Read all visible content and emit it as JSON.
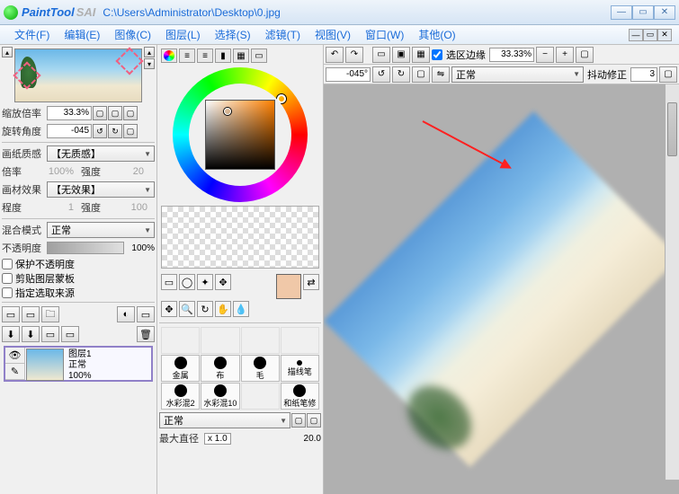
{
  "title": {
    "app": "PaintTool",
    "suffix": "SAI",
    "path": "C:\\Users\\Administrator\\Desktop\\0.jpg"
  },
  "menu": {
    "file": "文件(F)",
    "edit": "编辑(E)",
    "image": "图像(C)",
    "layer": "图层(L)",
    "select": "选择(S)",
    "filter": "滤镜(T)",
    "view": "视图(V)",
    "window": "窗口(W)",
    "other": "其他(O)"
  },
  "nav": {
    "zoom_label": "缩放倍率",
    "zoom_value": "33.3%",
    "rotate_label": "旋转角度",
    "rotate_value": "-045"
  },
  "paper": {
    "texture_label": "画纸质感",
    "texture_value": "【无质感】",
    "scale_label": "倍率",
    "scale_value": "100%",
    "intensity_label": "强度",
    "intensity_value": "20",
    "effect_label": "画材效果",
    "effect_value": "【无效果】",
    "degree_label": "程度",
    "degree_value": "1",
    "intensity2_label": "强度",
    "intensity2_value": "100"
  },
  "blend": {
    "mode_label": "混合模式",
    "mode_value": "正常",
    "opacity_label": "不透明度",
    "opacity_value": "100%"
  },
  "checks": {
    "preserve": "保护不透明度",
    "clip": "剪贴图层蒙板",
    "source": "指定选取来源"
  },
  "layer": {
    "name": "图层1",
    "mode": "正常",
    "opacity": "100%"
  },
  "brushes": {
    "r1": [
      "金属",
      "布",
      "毛",
      "描线笔"
    ],
    "r2": [
      "水彩混2",
      "水彩混10",
      "",
      "和纸笔修"
    ],
    "mode": "正常",
    "size_label": "最大直径",
    "size_x": "x 1.0",
    "size_value": "20.0"
  },
  "canvas_toolbar": {
    "sel_edge": "选区边缘",
    "zoom": "33.33%",
    "angle": "-045°",
    "mode": "正常",
    "stab_label": "抖动修正",
    "stab_value": "3"
  }
}
